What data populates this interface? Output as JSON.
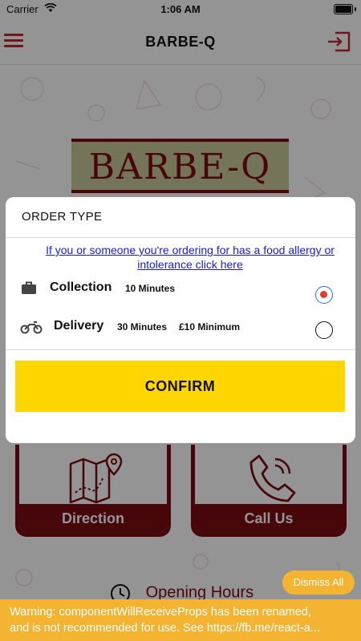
{
  "status": {
    "carrier": "Carrier",
    "time": "1:06 AM"
  },
  "navbar": {
    "title": "BARBE-Q"
  },
  "logo": {
    "text": "BARBE-Q"
  },
  "cards": [
    {
      "label": "Direction",
      "icon": "map-icon"
    },
    {
      "label": "Call Us",
      "icon": "phone-icon"
    }
  ],
  "hours": {
    "label": "Opening Hours"
  },
  "modal": {
    "title": "ORDER TYPE",
    "allergy_link": "If you or someone you're ordering for has a food allergy or intolerance click here",
    "options": [
      {
        "name": "Collection",
        "time": "10 Minutes",
        "minimum": "",
        "selected": true,
        "icon": "briefcase-icon"
      },
      {
        "name": "Delivery",
        "time": "30 Minutes",
        "minimum": "£10 Minimum",
        "selected": false,
        "icon": "scooter-icon"
      }
    ],
    "confirm_label": "CONFIRM"
  },
  "dismiss": {
    "label": "Dismiss All"
  },
  "warning": {
    "line1": "Warning: componentWillReceiveProps has been renamed,",
    "line2": "and is not recommended for use. See https://fb.me/react-a..."
  },
  "colors": {
    "brand": "#c0272d",
    "maroon": "#7a0c12",
    "confirm": "#ffd600",
    "warning": "#f4b431"
  }
}
